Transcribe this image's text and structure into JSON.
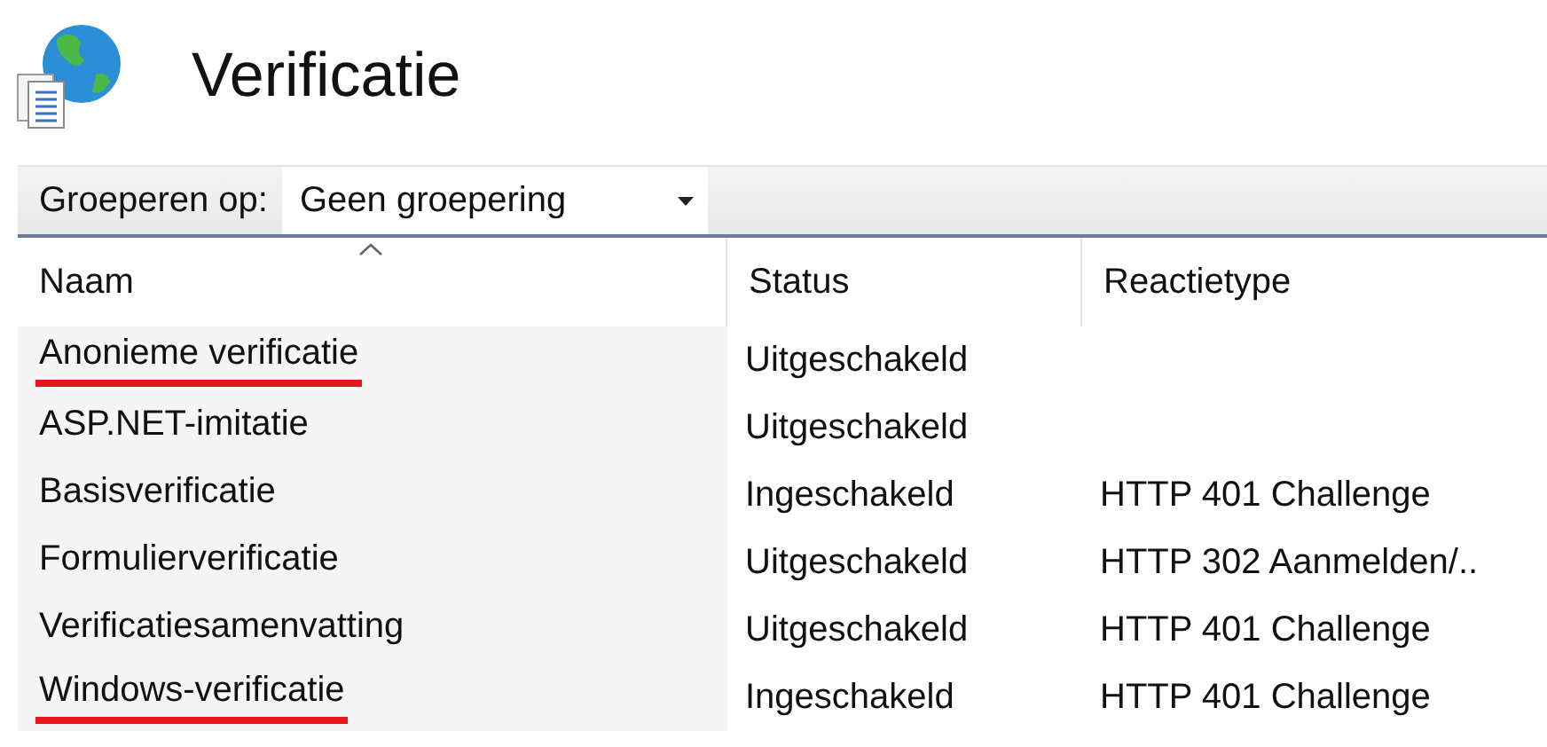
{
  "page": {
    "title": "Verificatie"
  },
  "toolbar": {
    "label": "Groeperen op:",
    "dropdown": {
      "value": "Geen groepering"
    }
  },
  "table": {
    "columns": [
      "Naam",
      "Status",
      "Reactietype"
    ],
    "rows": [
      {
        "name": "Anonieme verificatie",
        "status": "Uitgeschakeld",
        "response_type": "",
        "marked": true
      },
      {
        "name": "ASP.NET-imitatie",
        "status": "Uitgeschakeld",
        "response_type": "",
        "marked": false
      },
      {
        "name": "Basisverificatie",
        "status": "Ingeschakeld",
        "response_type": "HTTP 401 Challenge",
        "marked": false
      },
      {
        "name": "Formulierverificatie",
        "status": "Uitgeschakeld",
        "response_type": "HTTP 302 Aanmelden/..",
        "marked": false
      },
      {
        "name": "Verificatiesamenvatting",
        "status": "Uitgeschakeld",
        "response_type": "HTTP 401 Challenge",
        "marked": false
      },
      {
        "name": "Windows-verificatie",
        "status": "Ingeschakeld",
        "response_type": "HTTP 401 Challenge",
        "marked": true
      }
    ]
  }
}
